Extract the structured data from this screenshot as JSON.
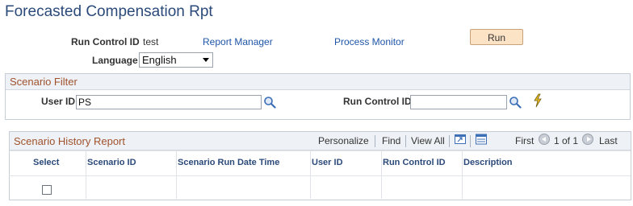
{
  "page": {
    "title": "Forecasted Compensation Rpt"
  },
  "run_control": {
    "label": "Run Control ID",
    "value": "test",
    "report_manager": "Report Manager",
    "process_monitor": "Process Monitor",
    "run_label": "Run",
    "language_label": "Language",
    "language_value": "English"
  },
  "scenario_filter": {
    "title": "Scenario Filter",
    "user_id_label": "User ID",
    "user_id_value": "PS",
    "run_control_label": "Run Control ID",
    "run_control_value": ""
  },
  "history": {
    "title": "Scenario History Report",
    "personalize": "Personalize",
    "find": "Find",
    "view_all": "View All",
    "first": "First",
    "page_info": "1 of 1",
    "last": "Last",
    "columns": [
      "Select",
      "Scenario ID",
      "Scenario Run Date Time",
      "User ID",
      "Run Control ID",
      "Description"
    ],
    "rows": [
      {
        "select": false,
        "scenario_id": "",
        "run_date_time": "",
        "user_id": "",
        "run_control_id": "",
        "description": ""
      }
    ]
  },
  "colors": {
    "title": "#2b4a7a",
    "link": "#1f55a8",
    "section_title": "#a0522d",
    "button_bg": "#fde3c6"
  },
  "icons": [
    "lookup-icon",
    "process-lightning-icon",
    "zoom-icon",
    "download-icon",
    "prev-icon",
    "next-icon"
  ]
}
